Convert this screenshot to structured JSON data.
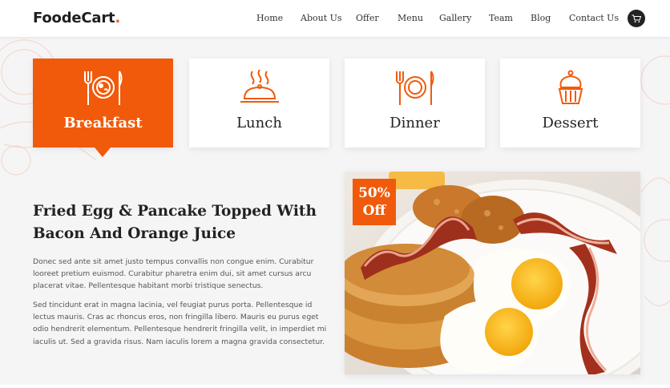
{
  "brand": {
    "name": "FoodeCart",
    "dot": ".",
    "accent_color": "#f15a24"
  },
  "nav": {
    "items": [
      "Home",
      "About Us",
      "Offer",
      "Menu",
      "Gallery",
      "Team",
      "Blog",
      "Contact Us"
    ],
    "cart_icon": "cart-icon"
  },
  "categories": [
    {
      "label": "Breakfast",
      "icon": "breakfast-plate-icon",
      "active": true
    },
    {
      "label": "Lunch",
      "icon": "cloche-icon",
      "active": false
    },
    {
      "label": "Dinner",
      "icon": "plate-cutlery-icon",
      "active": false
    },
    {
      "label": "Dessert",
      "icon": "cupcake-icon",
      "active": false
    }
  ],
  "content": {
    "title": "Fried Egg & Pancake Topped With Bacon And Orange Juice",
    "paragraph_1": "Donec sed ante sit amet justo tempus convallis non congue enim. Curabitur looreet pretium euismod. Curabitur pharetra enim dui, sit amet cursus arcu placerat vitae. Pellentesque habitant morbi tristique senectus.",
    "paragraph_2": "Sed tincidunt erat in magna lacinia, vel feugiat purus porta. Pellentesque id lectus mauris. Cras ac rhoncus eros, non fringilla libero. Mauris eu purus eget odio hendrerit elementum. Pellentesque hendrerit fringilla velit, in imperdiet mi iaculis ut. Sed a gravida risus. Nam iaculis lorem a magna gravida consectetur."
  },
  "offer": {
    "percent": "50%",
    "word": "Off"
  },
  "colors": {
    "primary": "#f15a0a",
    "background": "#f5f5f6",
    "text_dark": "#222222"
  }
}
